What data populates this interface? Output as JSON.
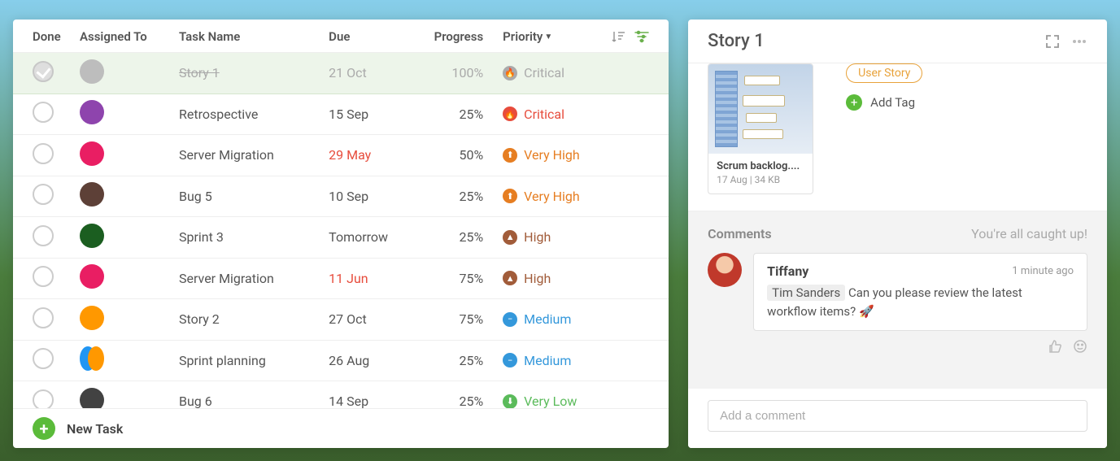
{
  "columns": {
    "done": "Done",
    "assigned": "Assigned To",
    "task": "Task Name",
    "due": "Due",
    "progress": "Progress",
    "priority": "Priority"
  },
  "tasks": [
    {
      "done": true,
      "avatar": "#bdbdbd",
      "name": "Story 1",
      "due": "21 Oct",
      "overdue": false,
      "progress": "100%",
      "priority_label": "Critical",
      "priority_class": "critical-muted"
    },
    {
      "done": false,
      "avatar": "#8e44ad",
      "name": "Retrospective",
      "due": "15 Sep",
      "overdue": false,
      "progress": "25%",
      "priority_label": "Critical",
      "priority_class": "critical"
    },
    {
      "done": false,
      "avatar": "#e91e63",
      "name": "Server Migration",
      "due": "29 May",
      "overdue": true,
      "progress": "50%",
      "priority_label": "Very High",
      "priority_class": "veryhigh"
    },
    {
      "done": false,
      "avatar": "#5d4037",
      "name": "Bug 5",
      "due": "10 Sep",
      "overdue": false,
      "progress": "25%",
      "priority_label": "Very High",
      "priority_class": "veryhigh"
    },
    {
      "done": false,
      "avatar": "#1b5e20",
      "name": "Sprint 3",
      "due": "Tomorrow",
      "overdue": false,
      "progress": "25%",
      "priority_label": "High",
      "priority_class": "high"
    },
    {
      "done": false,
      "avatar": "#e91e63",
      "name": "Server Migration",
      "due": "11 Jun",
      "overdue": true,
      "progress": "75%",
      "priority_label": "High",
      "priority_class": "high"
    },
    {
      "done": false,
      "avatar": "#ff9800",
      "name": "Story 2",
      "due": "27 Oct",
      "overdue": false,
      "progress": "75%",
      "priority_label": "Medium",
      "priority_class": "medium"
    },
    {
      "done": false,
      "avatar": "#2196f3",
      "avatar2": "#ff9800",
      "name": "Sprint planning",
      "due": "26 Aug",
      "overdue": false,
      "progress": "25%",
      "priority_label": "Medium",
      "priority_class": "medium"
    },
    {
      "done": false,
      "avatar": "#424242",
      "name": "Bug 6",
      "due": "14 Sep",
      "overdue": false,
      "progress": "25%",
      "priority_label": "Very Low",
      "priority_class": "verylow"
    }
  ],
  "new_task_label": "New Task",
  "detail": {
    "title": "Story 1",
    "attachment_name": "Scrum backlog....",
    "attachment_meta": "17 Aug | 34 KB",
    "tag_label": "User Story",
    "add_tag_label": "Add Tag"
  },
  "comments": {
    "heading": "Comments",
    "caught_up": "You're all caught up!",
    "item": {
      "author": "Tiffany",
      "time": "1 minute ago",
      "mention": "Tim Sanders",
      "text": " Can you please review the latest workflow items? 🚀"
    },
    "input_placeholder": "Add a comment"
  }
}
